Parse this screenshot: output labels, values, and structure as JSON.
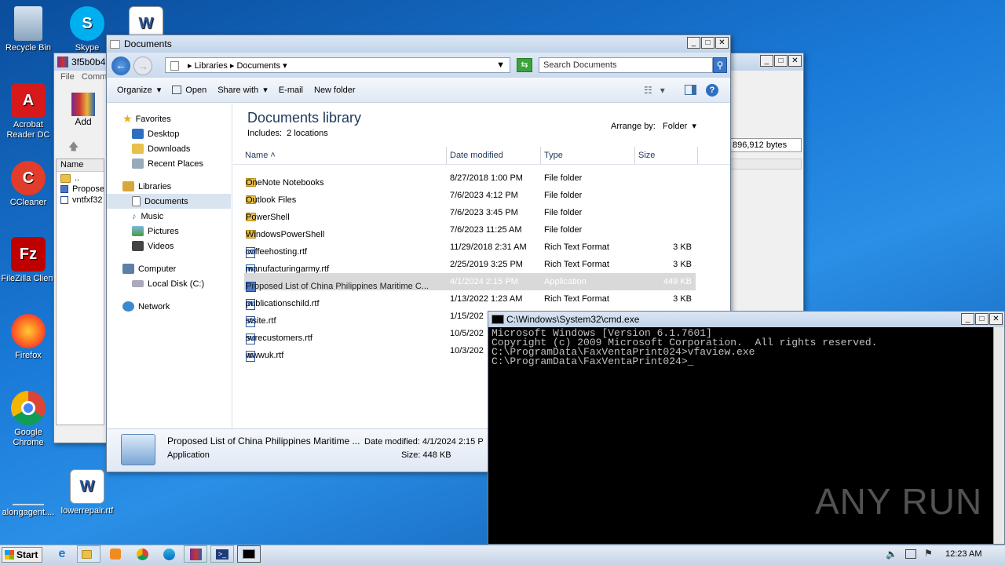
{
  "desktop": {
    "icons": [
      "Recycle Bin",
      "Skype",
      "Acrobat Reader DC",
      "CCleaner",
      "FileZilla Client",
      "Firefox",
      "Google Chrome",
      "alongagent....",
      "lowerrepair.rtf"
    ]
  },
  "winrar": {
    "title": "3f5b0b4",
    "menu_file": "File",
    "menu_comm": "Comm",
    "add_label": "Add",
    "name_col": "Name",
    "size_readout": "896,912 bytes",
    "rows": [
      "..",
      "Propose",
      "vntfxf32"
    ]
  },
  "explorer": {
    "title": "Documents",
    "breadcrumb": [
      "Libraries",
      "Documents"
    ],
    "search_placeholder": "Search Documents",
    "toolbar": {
      "organize": "Organize",
      "open": "Open",
      "share_with": "Share with",
      "email": "E-mail",
      "new_folder": "New folder"
    },
    "nav": {
      "favorites": "Favorites",
      "desktop": "Desktop",
      "downloads": "Downloads",
      "recent": "Recent Places",
      "libraries": "Libraries",
      "documents": "Documents",
      "music": "Music",
      "pictures": "Pictures",
      "videos": "Videos",
      "computer": "Computer",
      "local_disk": "Local Disk (C:)",
      "network": "Network"
    },
    "library_title": "Documents library",
    "includes_label": "Includes:",
    "includes_value": "2 locations",
    "arrange_label": "Arrange by:",
    "arrange_value": "Folder",
    "columns": {
      "name": "Name",
      "date": "Date modified",
      "type": "Type",
      "size": "Size"
    },
    "files": [
      {
        "name": "OneNote Notebooks",
        "date": "8/27/2018 1:00 PM",
        "type": "File folder",
        "size": ""
      },
      {
        "name": "Outlook Files",
        "date": "7/6/2023 4:12 PM",
        "type": "File folder",
        "size": ""
      },
      {
        "name": "PowerShell",
        "date": "7/6/2023 3:45 PM",
        "type": "File folder",
        "size": ""
      },
      {
        "name": "WindowsPowerShell",
        "date": "7/6/2023 11:25 AM",
        "type": "File folder",
        "size": ""
      },
      {
        "name": "coffeehosting.rtf",
        "date": "11/29/2018 2:31 AM",
        "type": "Rich Text Format",
        "size": "3 KB"
      },
      {
        "name": "manufacturingarmy.rtf",
        "date": "2/25/2019 3:25 PM",
        "type": "Rich Text Format",
        "size": "3 KB"
      },
      {
        "name": "Proposed List of China Philippines Maritime C...",
        "date": "4/1/2024 2:15 PM",
        "type": "Application",
        "size": "449 KB"
      },
      {
        "name": "publicationschild.rtf",
        "date": "1/13/2022 1:23 AM",
        "type": "Rich Text Format",
        "size": "3 KB"
      },
      {
        "name": "stsite.rtf",
        "date": "1/15/202",
        "type": "",
        "size": ""
      },
      {
        "name": "surecustomers.rtf",
        "date": "10/5/202",
        "type": "",
        "size": ""
      },
      {
        "name": "wwwuk.rtf",
        "date": "10/3/202",
        "type": "",
        "size": ""
      }
    ],
    "details": {
      "name": "Proposed List of China Philippines Maritime ...",
      "type": "Application",
      "date_label": "Date modified:",
      "date_value": "4/1/2024 2:15 P",
      "size_label": "Size:",
      "size_value": "448 KB"
    }
  },
  "cmd": {
    "title": "C:\\Windows\\System32\\cmd.exe",
    "lines": [
      "Microsoft Windows [Version 6.1.7601]",
      "Copyright (c) 2009 Microsoft Corporation.  All rights reserved.",
      "",
      "C:\\ProgramData\\FaxVentaPrint024>vfaview.exe",
      "",
      "C:\\ProgramData\\FaxVentaPrint024>_"
    ]
  },
  "watermark": "ANY RUN",
  "taskbar": {
    "start": "Start",
    "clock": "12:23 AM"
  }
}
